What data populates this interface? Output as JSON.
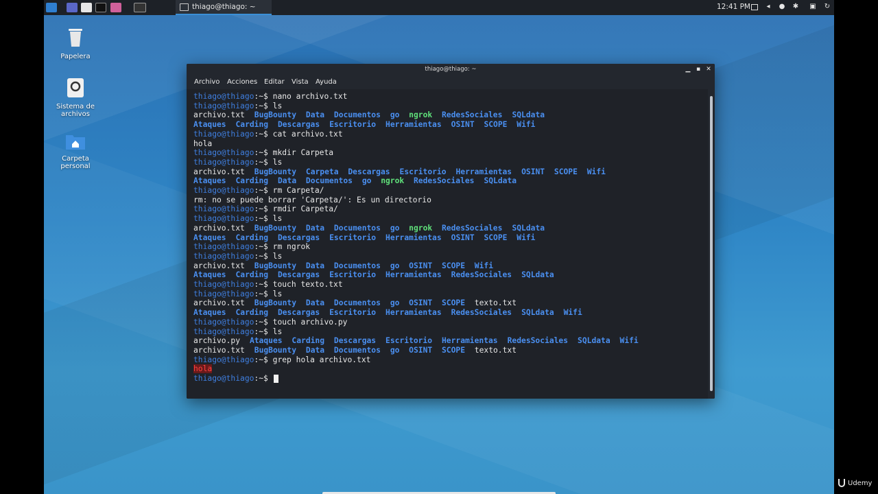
{
  "topbar": {
    "task_title": "thiago@thiago: ~",
    "clock": "12:41 PM"
  },
  "desktop_icons": [
    {
      "label": "Papelera"
    },
    {
      "label": "Sistema de archivos"
    },
    {
      "label": "Carpeta personal"
    }
  ],
  "terminal": {
    "title": "thiago@thiago: ~",
    "menu": [
      "Archivo",
      "Acciones",
      "Editar",
      "Vista",
      "Ayuda"
    ],
    "prompt": "thiago@thiago",
    "lines": [
      {
        "cmd": "nano archivo.txt"
      },
      {
        "cmd": "ls"
      },
      {
        "segs": [
          [
            "archivo.txt",
            "file"
          ],
          [
            "BugBounty",
            "dir"
          ],
          [
            "Data",
            "dir"
          ],
          [
            "Documentos",
            "dir"
          ],
          [
            "go",
            "dir"
          ],
          [
            "ngrok",
            "exec"
          ],
          [
            "RedesSociales",
            "dir"
          ],
          [
            "SQLdata",
            "dir"
          ]
        ]
      },
      {
        "segs": [
          [
            "Ataques",
            "dir"
          ],
          [
            "Carding",
            "dir"
          ],
          [
            "Descargas",
            "dir"
          ],
          [
            "Escritorio",
            "dir"
          ],
          [
            "Herramientas",
            "dir"
          ],
          [
            "OSINT",
            "dir"
          ],
          [
            "SCOPE",
            "dir"
          ],
          [
            "Wifi",
            "dir"
          ]
        ]
      },
      {
        "cmd": "cat archivo.txt"
      },
      {
        "text": "hola"
      },
      {
        "cmd": "mkdir Carpeta"
      },
      {
        "cmd": "ls"
      },
      {
        "segs": [
          [
            "archivo.txt",
            "file"
          ],
          [
            "BugBounty",
            "dir"
          ],
          [
            "Carpeta",
            "dir"
          ],
          [
            "Descargas",
            "dir"
          ],
          [
            "Escritorio",
            "dir"
          ],
          [
            "Herramientas",
            "dir"
          ],
          [
            "OSINT",
            "dir"
          ],
          [
            "SCOPE",
            "dir"
          ],
          [
            "Wifi",
            "dir"
          ]
        ]
      },
      {
        "segs": [
          [
            "Ataques",
            "dir"
          ],
          [
            "Carding",
            "dir"
          ],
          [
            "Data",
            "dir"
          ],
          [
            "Documentos",
            "dir"
          ],
          [
            "go",
            "dir"
          ],
          [
            "ngrok",
            "exec"
          ],
          [
            "RedesSociales",
            "dir"
          ],
          [
            "SQLdata",
            "dir"
          ]
        ]
      },
      {
        "cmd": "rm Carpeta/"
      },
      {
        "text": "rm: no se puede borrar 'Carpeta/': Es un directorio"
      },
      {
        "cmd": "rmdir Carpeta/"
      },
      {
        "cmd": "ls"
      },
      {
        "segs": [
          [
            "archivo.txt",
            "file"
          ],
          [
            "BugBounty",
            "dir"
          ],
          [
            "Data",
            "dir"
          ],
          [
            "Documentos",
            "dir"
          ],
          [
            "go",
            "dir"
          ],
          [
            "ngrok",
            "exec"
          ],
          [
            "RedesSociales",
            "dir"
          ],
          [
            "SQLdata",
            "dir"
          ]
        ]
      },
      {
        "segs": [
          [
            "Ataques",
            "dir"
          ],
          [
            "Carding",
            "dir"
          ],
          [
            "Descargas",
            "dir"
          ],
          [
            "Escritorio",
            "dir"
          ],
          [
            "Herramientas",
            "dir"
          ],
          [
            "OSINT",
            "dir"
          ],
          [
            "SCOPE",
            "dir"
          ],
          [
            "Wifi",
            "dir"
          ]
        ]
      },
      {
        "cmd": "rm ngrok"
      },
      {
        "cmd": "ls"
      },
      {
        "segs": [
          [
            "archivo.txt",
            "file"
          ],
          [
            "BugBounty",
            "dir"
          ],
          [
            "Data",
            "dir"
          ],
          [
            "Documentos",
            "dir"
          ],
          [
            "go",
            "dir"
          ],
          [
            "OSINT",
            "dir"
          ],
          [
            "SCOPE",
            "dir"
          ],
          [
            "Wifi",
            "dir"
          ]
        ]
      },
      {
        "segs": [
          [
            "Ataques",
            "dir"
          ],
          [
            "Carding",
            "dir"
          ],
          [
            "Descargas",
            "dir"
          ],
          [
            "Escritorio",
            "dir"
          ],
          [
            "Herramientas",
            "dir"
          ],
          [
            "RedesSociales",
            "dir"
          ],
          [
            "SQLdata",
            "dir"
          ]
        ]
      },
      {
        "cmd": "touch texto.txt"
      },
      {
        "cmd": "ls"
      },
      {
        "segs": [
          [
            "archivo.txt",
            "file"
          ],
          [
            "BugBounty",
            "dir"
          ],
          [
            "Data",
            "dir"
          ],
          [
            "Documentos",
            "dir"
          ],
          [
            "go",
            "dir"
          ],
          [
            "OSINT",
            "dir"
          ],
          [
            "SCOPE",
            "dir"
          ],
          [
            "texto.txt",
            "file"
          ]
        ]
      },
      {
        "segs": [
          [
            "Ataques",
            "dir"
          ],
          [
            "Carding",
            "dir"
          ],
          [
            "Descargas",
            "dir"
          ],
          [
            "Escritorio",
            "dir"
          ],
          [
            "Herramientas",
            "dir"
          ],
          [
            "RedesSociales",
            "dir"
          ],
          [
            "SQLdata",
            "dir"
          ],
          [
            "Wifi",
            "dir"
          ]
        ]
      },
      {
        "cmd": "touch archivo.py"
      },
      {
        "cmd": "ls"
      },
      {
        "segs": [
          [
            "archivo.py",
            "file"
          ],
          [
            "Ataques",
            "dir"
          ],
          [
            "Carding",
            "dir"
          ],
          [
            "Descargas",
            "dir"
          ],
          [
            "Escritorio",
            "dir"
          ],
          [
            "Herramientas",
            "dir"
          ],
          [
            "RedesSociales",
            "dir"
          ],
          [
            "SQLdata",
            "dir"
          ],
          [
            "Wifi",
            "dir"
          ]
        ]
      },
      {
        "segs": [
          [
            "archivo.txt",
            "file"
          ],
          [
            "BugBounty",
            "dir"
          ],
          [
            "Data",
            "dir"
          ],
          [
            "Documentos",
            "dir"
          ],
          [
            "go",
            "dir"
          ],
          [
            "OSINT",
            "dir"
          ],
          [
            "SCOPE",
            "dir"
          ],
          [
            "texto.txt",
            "file"
          ]
        ]
      },
      {
        "cmd": "grep hola archivo.txt"
      },
      {
        "highlight": "hola"
      },
      {
        "cmd": "",
        "cursor": true
      }
    ]
  },
  "watermark": "Udemy",
  "colors": {
    "prompt": "#3f7fe0",
    "dir": "#4a8ff0",
    "exec": "#5fe07a",
    "terminal_bg": "#1f2228",
    "highlight": "#ff4040"
  }
}
